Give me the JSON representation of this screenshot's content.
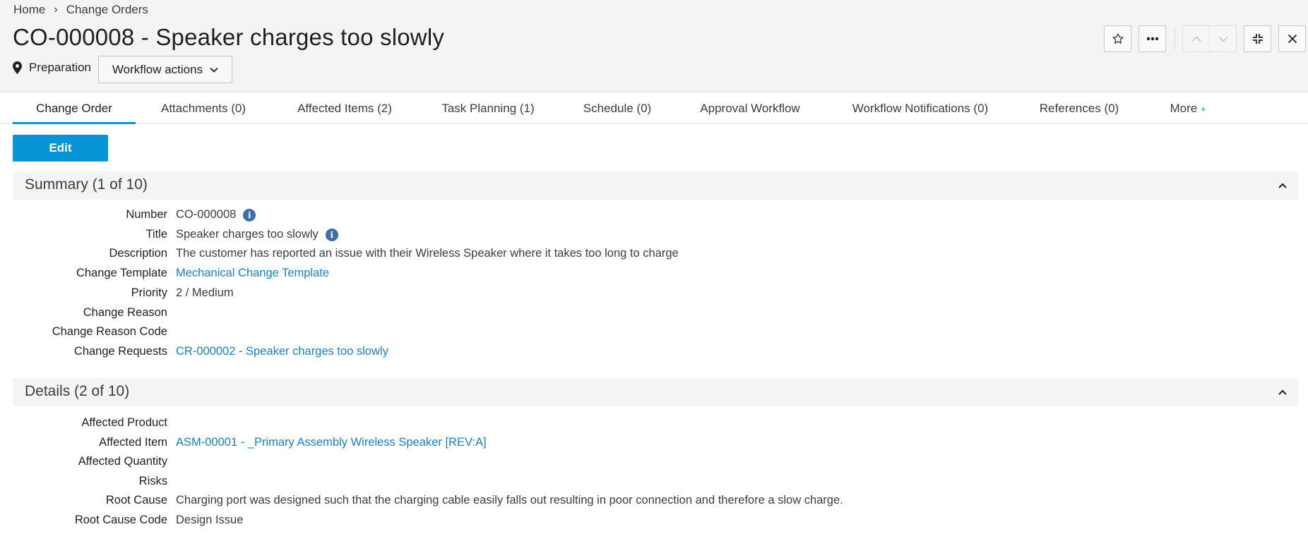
{
  "breadcrumb": {
    "home": "Home",
    "sep": "›",
    "current": "Change Orders"
  },
  "header": {
    "title": "CO-000008 - Speaker charges too slowly",
    "status": "Preparation",
    "workflow_label": "Workflow actions"
  },
  "icons": {
    "star": "star-icon",
    "more": "ellipsis-icon",
    "up": "chevron-up-icon",
    "down": "chevron-down-icon",
    "collapse": "collapse-icon",
    "close": "close-icon"
  },
  "tabs": [
    {
      "label": "Change Order"
    },
    {
      "label": "Attachments (0)"
    },
    {
      "label": "Affected Items (2)"
    },
    {
      "label": "Task Planning (1)"
    },
    {
      "label": "Schedule (0)"
    },
    {
      "label": "Approval Workflow"
    },
    {
      "label": "Workflow Notifications (0)"
    },
    {
      "label": "References (0)"
    },
    {
      "label": "More",
      "suffix": "+"
    }
  ],
  "actions": {
    "edit_label": "Edit"
  },
  "summary": {
    "title": "Summary (1 of 10)",
    "fields": [
      {
        "label": "Number",
        "value": "CO-000008"
      },
      {
        "label": "Title",
        "value": "Speaker charges too slowly"
      },
      {
        "label": "Description",
        "value": "The customer has reported an issue with their Wireless Speaker where it takes too long to charge"
      },
      {
        "label": "Change Template",
        "value": "Mechanical Change Template"
      },
      {
        "label": "Priority",
        "value": "2 / Medium"
      },
      {
        "label": "Change Reason",
        "value": ""
      },
      {
        "label": "Change Reason Code",
        "value": ""
      },
      {
        "label": "Change Requests",
        "value": "CR-000002 - Speaker charges too slowly"
      }
    ]
  },
  "details": {
    "title": "Details (2 of 10)",
    "fields": [
      {
        "label": "Affected Product",
        "value": ""
      },
      {
        "label": "Affected Item",
        "value": "ASM-00001 - _Primary Assembly Wireless Speaker [REV:A]"
      },
      {
        "label": "Affected Quantity",
        "value": ""
      },
      {
        "label": "Risks",
        "value": ""
      },
      {
        "label": "Root Cause",
        "value": "Charging port was designed such that the charging cable easily falls out resulting in poor connection and therefore a slow charge."
      },
      {
        "label": "Root Cause Code",
        "value": "Design Issue"
      }
    ]
  },
  "info_glyph": "i",
  "colors": {
    "accent": "#0696d7",
    "link": "#1483c6",
    "info": "#3f6fa8"
  }
}
